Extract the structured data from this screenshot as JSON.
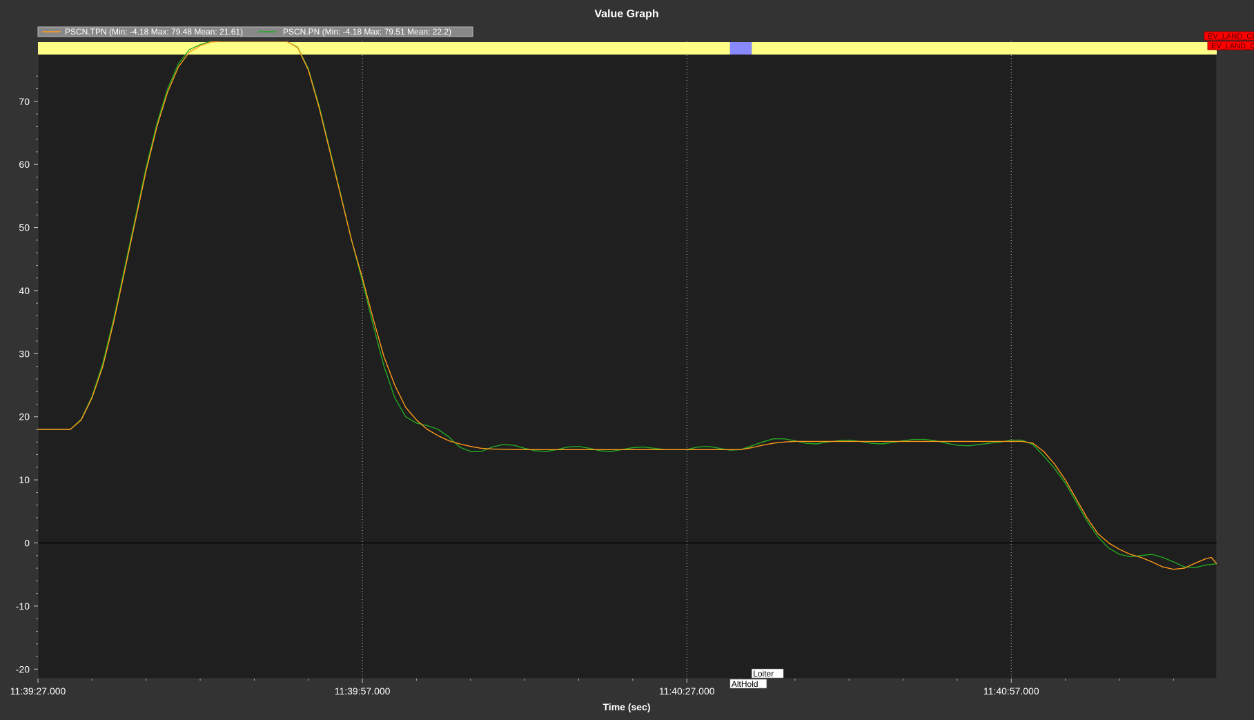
{
  "window": {
    "title": "Value Graph"
  },
  "chart_data": {
    "type": "line",
    "title": "Value Graph",
    "xlabel": "Time (sec)",
    "ylabel": "",
    "x_unit": "seconds since 11:39:27.000",
    "xlim": [
      0,
      109
    ],
    "ylim": [
      -21.5,
      79.5
    ],
    "x_ticks": [
      {
        "value": 0,
        "label": "11:39:27.000"
      },
      {
        "value": 30,
        "label": "11:39:57.000"
      },
      {
        "value": 60,
        "label": "11:40:27.000"
      },
      {
        "value": 90,
        "label": "11:40:57.000"
      }
    ],
    "y_ticks": [
      -20,
      -10,
      0,
      10,
      20,
      30,
      40,
      50,
      60,
      70
    ],
    "grid": "vertical dotted at major time ticks, solid line at y=0",
    "legend_position": "top-left",
    "series": [
      {
        "name": "PSCN.TPN",
        "legend": "PSCN.TPN  (Min: -4.18 Max: 79.48 Mean: 21.61)",
        "color": "#ff9a1a",
        "points": [
          [
            0,
            18.0
          ],
          [
            3,
            18.0
          ],
          [
            4,
            19.5
          ],
          [
            5,
            23.0
          ],
          [
            6,
            28.0
          ],
          [
            7,
            35.0
          ],
          [
            8,
            43.0
          ],
          [
            9,
            51.0
          ],
          [
            10,
            59.0
          ],
          [
            11,
            66.0
          ],
          [
            12,
            71.5
          ],
          [
            13,
            75.5
          ],
          [
            14,
            77.8
          ],
          [
            15,
            78.8
          ],
          [
            16,
            79.4
          ],
          [
            17,
            79.5
          ],
          [
            18,
            79.5
          ],
          [
            19,
            79.5
          ],
          [
            20,
            79.5
          ],
          [
            21,
            79.5
          ],
          [
            22,
            79.5
          ],
          [
            23,
            79.5
          ],
          [
            24,
            78.5
          ],
          [
            25,
            75.0
          ],
          [
            26,
            69.0
          ],
          [
            27,
            62.0
          ],
          [
            28,
            55.0
          ],
          [
            29,
            48.0
          ],
          [
            30,
            42.0
          ],
          [
            31,
            35.5
          ],
          [
            32,
            29.5
          ],
          [
            33,
            25.0
          ],
          [
            34,
            21.5
          ],
          [
            35,
            19.5
          ],
          [
            36,
            18.0
          ],
          [
            37,
            17.0
          ],
          [
            38,
            16.2
          ],
          [
            39,
            15.7
          ],
          [
            40,
            15.3
          ],
          [
            41,
            15.0
          ],
          [
            42,
            14.9
          ],
          [
            45,
            14.8
          ],
          [
            50,
            14.8
          ],
          [
            55,
            14.8
          ],
          [
            60,
            14.8
          ],
          [
            65,
            14.8
          ],
          [
            66,
            15.1
          ],
          [
            67,
            15.5
          ],
          [
            68,
            15.8
          ],
          [
            69,
            16.0
          ],
          [
            70,
            16.1
          ],
          [
            75,
            16.1
          ],
          [
            80,
            16.1
          ],
          [
            85,
            16.1
          ],
          [
            90,
            16.1
          ],
          [
            91,
            16.1
          ],
          [
            92,
            15.8
          ],
          [
            93,
            14.5
          ],
          [
            94,
            12.5
          ],
          [
            95,
            10.0
          ],
          [
            96,
            7.0
          ],
          [
            97,
            4.0
          ],
          [
            98,
            1.5
          ],
          [
            99,
            0.0
          ],
          [
            100,
            -1.0
          ],
          [
            101,
            -1.8
          ],
          [
            102,
            -2.3
          ],
          [
            103,
            -3.0
          ],
          [
            104,
            -3.8
          ],
          [
            105,
            -4.18
          ],
          [
            106,
            -4.0
          ],
          [
            107,
            -3.2
          ],
          [
            108,
            -2.5
          ],
          [
            108.5,
            -2.3
          ],
          [
            109,
            -3.3
          ]
        ]
      },
      {
        "name": "PSCN.PN",
        "legend": "PSCN.PN  (Min: -4.18 Max: 79.51 Mean: 22.2)",
        "color": "#22aa22",
        "points": [
          [
            0,
            18.0
          ],
          [
            3,
            18.0
          ],
          [
            4,
            19.6
          ],
          [
            5,
            23.2
          ],
          [
            6,
            28.5
          ],
          [
            7,
            35.5
          ],
          [
            8,
            43.5
          ],
          [
            9,
            51.5
          ],
          [
            10,
            59.5
          ],
          [
            11,
            66.5
          ],
          [
            12,
            72.0
          ],
          [
            13,
            76.0
          ],
          [
            14,
            78.2
          ],
          [
            15,
            79.0
          ],
          [
            16,
            79.5
          ],
          [
            17,
            79.51
          ],
          [
            18,
            79.5
          ],
          [
            19,
            79.5
          ],
          [
            20,
            79.5
          ],
          [
            21,
            79.5
          ],
          [
            22,
            79.5
          ],
          [
            23,
            79.5
          ],
          [
            24,
            78.6
          ],
          [
            25,
            75.2
          ],
          [
            26,
            69.3
          ],
          [
            27,
            62.3
          ],
          [
            28,
            55.2
          ],
          [
            29,
            48.0
          ],
          [
            30,
            41.5
          ],
          [
            31,
            34.5
          ],
          [
            32,
            28.0
          ],
          [
            33,
            23.0
          ],
          [
            34,
            20.0
          ],
          [
            35,
            19.0
          ],
          [
            36,
            18.6
          ],
          [
            37,
            18.0
          ],
          [
            38,
            16.8
          ],
          [
            39,
            15.2
          ],
          [
            40,
            14.5
          ],
          [
            41,
            14.5
          ],
          [
            42,
            15.2
          ],
          [
            43,
            15.6
          ],
          [
            44,
            15.5
          ],
          [
            45,
            15.0
          ],
          [
            46,
            14.6
          ],
          [
            47,
            14.5
          ],
          [
            48,
            14.8
          ],
          [
            49,
            15.2
          ],
          [
            50,
            15.3
          ],
          [
            51,
            15.0
          ],
          [
            52,
            14.6
          ],
          [
            53,
            14.5
          ],
          [
            54,
            14.8
          ],
          [
            55,
            15.1
          ],
          [
            56,
            15.2
          ],
          [
            57,
            15.0
          ],
          [
            58,
            14.8
          ],
          [
            60,
            14.8
          ],
          [
            61,
            15.2
          ],
          [
            62,
            15.3
          ],
          [
            63,
            15.0
          ],
          [
            64,
            14.7
          ],
          [
            65,
            14.8
          ],
          [
            66,
            15.4
          ],
          [
            67,
            16.0
          ],
          [
            68,
            16.5
          ],
          [
            69,
            16.5
          ],
          [
            70,
            16.2
          ],
          [
            71,
            15.8
          ],
          [
            72,
            15.7
          ],
          [
            73,
            16.0
          ],
          [
            74,
            16.2
          ],
          [
            75,
            16.3
          ],
          [
            76,
            16.1
          ],
          [
            77,
            15.8
          ],
          [
            78,
            15.7
          ],
          [
            79,
            15.9
          ],
          [
            80,
            16.2
          ],
          [
            81,
            16.4
          ],
          [
            82,
            16.4
          ],
          [
            83,
            16.2
          ],
          [
            84,
            15.8
          ],
          [
            85,
            15.5
          ],
          [
            86,
            15.4
          ],
          [
            87,
            15.6
          ],
          [
            88,
            15.8
          ],
          [
            89,
            16.0
          ],
          [
            90,
            16.3
          ],
          [
            91,
            16.3
          ],
          [
            92,
            15.6
          ],
          [
            93,
            13.8
          ],
          [
            94,
            11.8
          ],
          [
            95,
            9.5
          ],
          [
            96,
            6.5
          ],
          [
            97,
            3.5
          ],
          [
            98,
            1.0
          ],
          [
            99,
            -0.8
          ],
          [
            100,
            -1.8
          ],
          [
            101,
            -2.2
          ],
          [
            102,
            -2.0
          ],
          [
            103,
            -1.8
          ],
          [
            104,
            -2.3
          ],
          [
            105,
            -3.0
          ],
          [
            106,
            -3.8
          ],
          [
            107,
            -3.9
          ],
          [
            108,
            -3.5
          ],
          [
            108.5,
            -3.4
          ],
          [
            109,
            -3.3
          ]
        ]
      }
    ],
    "mode_bar": {
      "color": "#ffff88",
      "segments": [
        {
          "start": 0,
          "end": 64,
          "color": "#ffff88"
        },
        {
          "start": 64,
          "end": 66,
          "color": "#8888ff"
        },
        {
          "start": 66,
          "end": 109,
          "color": "#ffff88"
        }
      ]
    },
    "mode_labels": [
      {
        "text": "Loiter",
        "x": 66,
        "row": 1
      },
      {
        "text": "AltHold",
        "x": 64,
        "row": 2
      }
    ],
    "event_markers": [
      {
        "text": "EV_LAND_COMPLETE_MAYBE",
        "row": 1,
        "color": "#ff0000"
      },
      {
        "text": "EV_LAND_COMPLETE",
        "row": 2,
        "color": "#ff0000"
      }
    ]
  }
}
